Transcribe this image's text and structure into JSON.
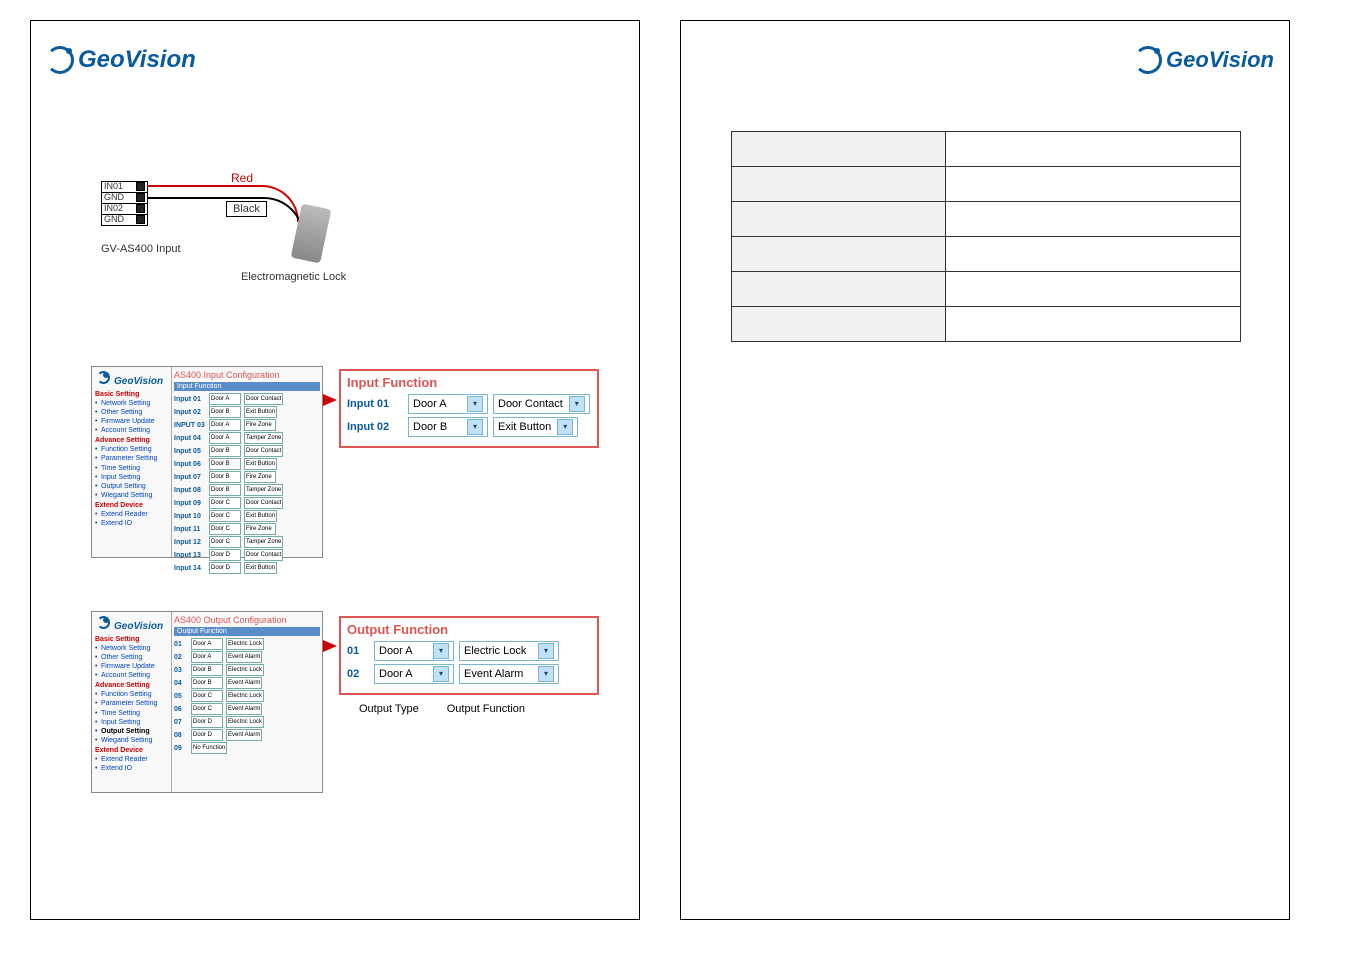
{
  "brand": "GeoVision",
  "wiring": {
    "terminals": [
      "IN01",
      "GND",
      "IN02",
      "GND"
    ],
    "input_label": "GV-AS400 Input",
    "wire_red": "Red",
    "wire_black": "Black",
    "lock_label": "Electromagnetic Lock"
  },
  "input_config": {
    "title": "AS400 Input Configuration",
    "section": "Input Function",
    "nav": {
      "basic": "Basic Setting",
      "basic_items": [
        "Network Setting",
        "Other Setting",
        "Firmware Update",
        "Account Setting"
      ],
      "advance": "Advance Setting",
      "advance_items": [
        "Function Setting",
        "Parameter Setting",
        "Time Setting",
        "Input Setting",
        "Output Setting",
        "Wiegand Setting"
      ],
      "extend": "Extend Device",
      "extend_items": [
        "Extend Reader",
        "Extend IO"
      ]
    },
    "rows": [
      {
        "id": "Input 01",
        "door": "Door A",
        "fn": "Door Contact"
      },
      {
        "id": "Input 02",
        "door": "Door B",
        "fn": "Exit Button"
      },
      {
        "id": "INPUT 03",
        "door": "Door A",
        "fn": "Fire Zone"
      },
      {
        "id": "Input 04",
        "door": "Door A",
        "fn": "Tamper Zone"
      },
      {
        "id": "Input 05",
        "door": "Door B",
        "fn": "Door Contact"
      },
      {
        "id": "Input 06",
        "door": "Door B",
        "fn": "Exit Button"
      },
      {
        "id": "Input 07",
        "door": "Door B",
        "fn": "Fire Zone"
      },
      {
        "id": "Input 08",
        "door": "Door B",
        "fn": "Tamper Zone"
      },
      {
        "id": "Input 09",
        "door": "Door C",
        "fn": "Door Contact"
      },
      {
        "id": "Input 10",
        "door": "Door C",
        "fn": "Exit Button"
      },
      {
        "id": "Input 11",
        "door": "Door C",
        "fn": "Fire Zone"
      },
      {
        "id": "Input 12",
        "door": "Door C",
        "fn": "Tamper Zone"
      },
      {
        "id": "Input 13",
        "door": "Door D",
        "fn": "Door Contact"
      },
      {
        "id": "Input 14",
        "door": "Door D",
        "fn": "Exit Button"
      }
    ]
  },
  "output_config": {
    "title": "AS400 Output Configuration",
    "section": "Output Function",
    "rows": [
      {
        "id": "01",
        "door": "Door A",
        "fn": "Electric Lock"
      },
      {
        "id": "02",
        "door": "Door A",
        "fn": "Event Alarm"
      },
      {
        "id": "03",
        "door": "Door B",
        "fn": "Electric Lock"
      },
      {
        "id": "04",
        "door": "Door B",
        "fn": "Event Alarm"
      },
      {
        "id": "05",
        "door": "Door C",
        "fn": "Electric Lock"
      },
      {
        "id": "06",
        "door": "Door C",
        "fn": "Event Alarm"
      },
      {
        "id": "07",
        "door": "Door D",
        "fn": "Electric Lock"
      },
      {
        "id": "08",
        "door": "Door D",
        "fn": "Event Alarm"
      },
      {
        "id": "09",
        "door": "No Function",
        "fn": ""
      }
    ]
  },
  "callout_input": {
    "title": "Input Function",
    "rows": [
      {
        "id": "Input 01",
        "door": "Door A",
        "fn": "Door Contact"
      },
      {
        "id": "Input 02",
        "door": "Door B",
        "fn": "Exit Button"
      }
    ]
  },
  "callout_output": {
    "title": "Output Function",
    "rows": [
      {
        "id": "01",
        "door": "Door A",
        "fn": "Electric Lock"
      },
      {
        "id": "02",
        "door": "Door A",
        "fn": "Event Alarm"
      }
    ],
    "caption_type": "Output Type",
    "caption_fn": "Output Function"
  },
  "right_table": {
    "rows": [
      [
        "",
        ""
      ],
      [
        "",
        ""
      ],
      [
        "",
        ""
      ],
      [
        "",
        ""
      ],
      [
        "",
        ""
      ],
      [
        "",
        ""
      ]
    ]
  }
}
